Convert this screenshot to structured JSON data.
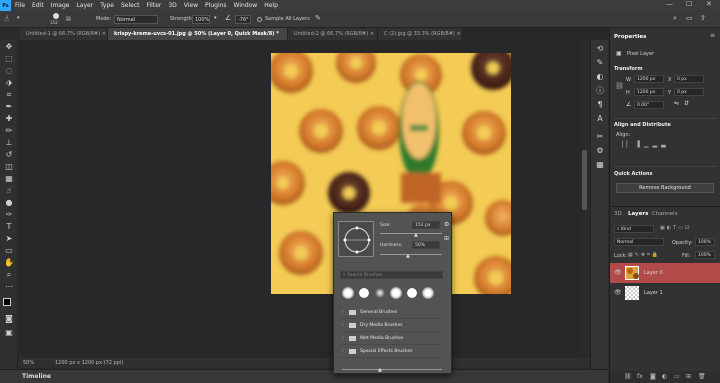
{
  "menubar": {
    "logo": "Ps",
    "items": [
      "File",
      "Edit",
      "Image",
      "Layer",
      "Type",
      "Select",
      "Filter",
      "3D",
      "View",
      "Plugins",
      "Window",
      "Help"
    ],
    "minimize": "—",
    "maximize": "☐",
    "close": "✕"
  },
  "options": {
    "size": "152",
    "mode_label": "Mode:",
    "mode_value": "Normal",
    "strength_label": "Strength:",
    "strength_value": "100%",
    "angle_value": "-76°",
    "sample_all_layers": "Sample All Layers"
  },
  "tabs": [
    {
      "label": "Untitled-1 @ 66.7% (RGB/8#) ×",
      "active": false
    },
    {
      "label": "krispy-kreme-uvcs-01.jpg @ 50% (Layer 0, Quick Mask/8) *",
      "active": true
    },
    {
      "label": "Untitled-2 @ 66.7% (RGB/8#) ×",
      "active": false
    },
    {
      "label": "C (2).jpg @ 33.3% (RGB/8#) ×",
      "active": false
    }
  ],
  "status": {
    "zoom": "50%",
    "info": "1200 px x 1200 px (72 ppi)"
  },
  "timeline": {
    "label": "Timeline"
  },
  "brush_popup": {
    "size_label": "Size:",
    "size_value": "152 px",
    "hardness_label": "Hardness:",
    "hardness_value": "50%",
    "search_placeholder": "Search Brushes",
    "folders": [
      "General Brushes",
      "Dry Media Brushes",
      "Wet Media Brushes",
      "Special Effects Brushes"
    ]
  },
  "properties": {
    "title": "Properties",
    "subtitle": "Pixel Layer",
    "transform": "Transform",
    "w_label": "W",
    "w_value": "1200 px",
    "x_label": "X",
    "x_value": "0 px",
    "h_label": "H",
    "h_value": "1200 px",
    "y_label": "Y",
    "y_value": "0 px",
    "angle_value": "0.00°",
    "align": "Align and Distribute",
    "align_sub": "Align:",
    "quick_actions": "Quick Actions",
    "remove_bg": "Remove Background"
  },
  "layers_panel": {
    "tabs": [
      "3D",
      "Layers",
      "Channels"
    ],
    "kind": "Kind",
    "blend_mode": "Normal",
    "opacity_label": "Opacity:",
    "opacity_value": "100%",
    "lock_label": "Lock:",
    "fill_label": "Fill:",
    "fill_value": "100%",
    "layers": [
      {
        "name": "Layer 0",
        "selected": true
      },
      {
        "name": "Layer 1",
        "selected": false
      }
    ],
    "bottom_icons": [
      "link",
      "fx",
      "mask",
      "adjust",
      "group",
      "new",
      "trash"
    ]
  },
  "colors": {
    "accent": "#31a8ff",
    "selected_layer": "#b24a4a",
    "canvas_bg": "#f2c94c"
  }
}
